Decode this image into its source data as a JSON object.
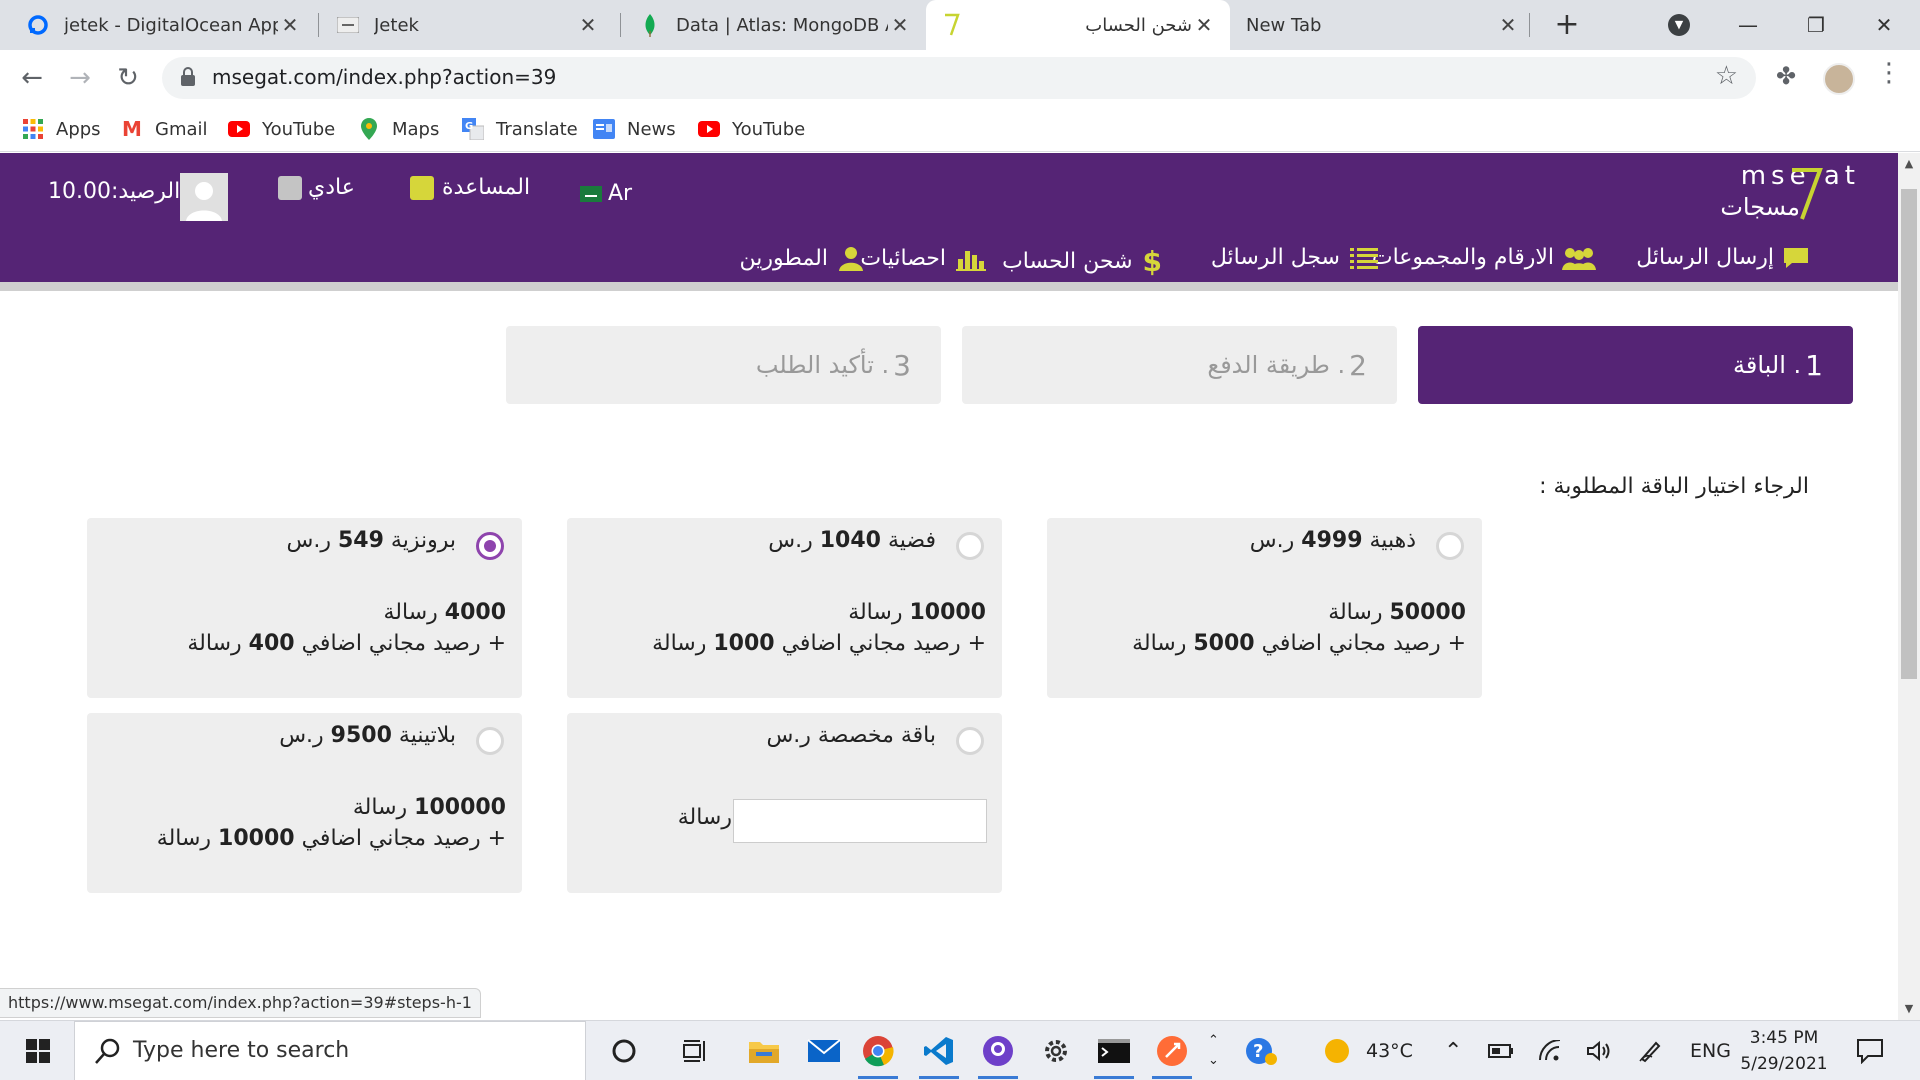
{
  "browser": {
    "tabs": [
      {
        "title": "jetek - DigitalOcean App P",
        "icon": "digitalocean-icon",
        "color": "#0069ff"
      },
      {
        "title": "Jetek",
        "icon": "site-favicon-icon",
        "color": "#888888"
      },
      {
        "title": "Data | Atlas: MongoDB Atl",
        "icon": "mongodb-leaf-icon",
        "color": "#13aa52"
      },
      {
        "title": "شحن الحساب",
        "icon": "msegat-favicon-icon",
        "color": "#c7d431"
      },
      {
        "title": "New Tab",
        "icon": "",
        "color": ""
      }
    ],
    "active_tab_index": 3,
    "url": "msegat.com/index.php?action=39",
    "bookmarks": [
      {
        "label": "Apps",
        "icon": "apps-grid-icon"
      },
      {
        "label": "Gmail",
        "icon": "gmail-icon"
      },
      {
        "label": "YouTube",
        "icon": "youtube-icon"
      },
      {
        "label": "Maps",
        "icon": "maps-pin-icon"
      },
      {
        "label": "Translate",
        "icon": "translate-icon"
      },
      {
        "label": "News",
        "icon": "news-icon"
      },
      {
        "label": "YouTube",
        "icon": "youtube-icon"
      }
    ],
    "status_url": "https://www.msegat.com/index.php?action=39#steps-h-1"
  },
  "header": {
    "logo_latin": "mse  at",
    "logo_arabic": "مسجات",
    "balance_label": "الرصيد:10.00",
    "account_type": "عادي",
    "help": "المساعدة",
    "language": "Ar",
    "nav": [
      {
        "label": "إرسال الرسائل",
        "icon": "chat-bubble-icon"
      },
      {
        "label": "الارقام والمجموعات",
        "icon": "group-users-icon"
      },
      {
        "label": "سجل الرسائل",
        "icon": "list-icon"
      },
      {
        "label": "شحن الحساب",
        "icon": "dollar-icon"
      },
      {
        "label": "احصائيات",
        "icon": "bar-chart-icon"
      },
      {
        "label": "المطورين",
        "icon": "developer-user-icon"
      }
    ],
    "accent_color": "#552475"
  },
  "steps": [
    {
      "num": "1",
      "label": ". الباقة",
      "active": true
    },
    {
      "num": "2",
      "label": ". طريقة الدفع",
      "active": false
    },
    {
      "num": "3",
      "label": ". تأكيد الطلب",
      "active": false
    }
  ],
  "prompt": "الرجاء اختيار الباقة المطلوبة :",
  "packages": [
    {
      "name": "ذهبية",
      "price": "4999",
      "currency": "ر.س",
      "messages": "50000",
      "messages_unit": "رسالة",
      "bonus_prefix": "+ رصيد مجاني اضافي",
      "bonus": "5000",
      "bonus_unit": "رسالة",
      "selected": false
    },
    {
      "name": "فضية",
      "price": "1040",
      "currency": "ر.س",
      "messages": "10000",
      "messages_unit": "رسالة",
      "bonus_prefix": "+ رصيد مجاني اضافي",
      "bonus": "1000",
      "bonus_unit": "رسالة",
      "selected": false
    },
    {
      "name": "برونزية",
      "price": "549",
      "currency": "ر.س",
      "messages": "4000",
      "messages_unit": "رسالة",
      "bonus_prefix": "+ رصيد مجاني اضافي",
      "bonus": "400",
      "bonus_unit": "رسالة",
      "selected": true
    },
    {
      "name": "باقة مخصصة",
      "price": "",
      "currency": "ر.س",
      "custom_unit": "رسالة",
      "custom_value": "",
      "selected": false
    },
    {
      "name": "بلاتينية",
      "price": "9500",
      "currency": "ر.س",
      "messages": "100000",
      "messages_unit": "رسالة",
      "bonus_prefix": "+ رصيد مجاني اضافي",
      "bonus": "10000",
      "bonus_unit": "رسالة",
      "selected": false
    }
  ],
  "taskbar": {
    "search_placeholder": "Type here to search",
    "weather": "43°C",
    "language": "ENG",
    "time": "3:45 PM",
    "date": "5/29/2021"
  }
}
